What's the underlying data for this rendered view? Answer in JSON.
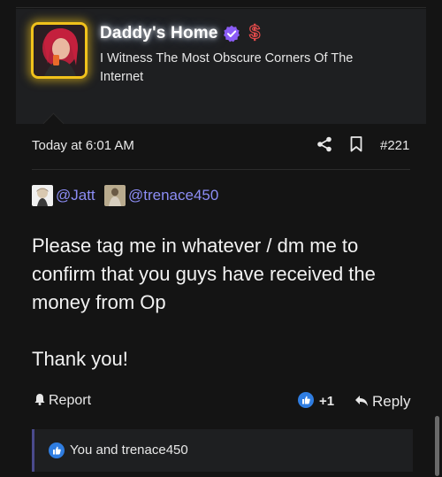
{
  "author": {
    "username": "Daddy's Home",
    "title": "I Witness The Most Obscure Corners Of The Internet",
    "badge_icon": "verified-check-icon",
    "extra_icon": "dollar-icon",
    "accent_color": "#8b5cf6"
  },
  "post": {
    "timestamp": "Today at 6:01 AM",
    "number": "#221",
    "mentions": [
      "@Jatt",
      "@trenace450"
    ],
    "message": "Please tag me in whatever / dm me to confirm that you guys have received the money from Op\n\nThank you!"
  },
  "actions": {
    "report_label": "Report",
    "like_count": "+1",
    "reply_label": "Reply"
  },
  "reactions": {
    "text": "You and trenace450"
  },
  "colors": {
    "background": "#141414",
    "card": "#1e1f21",
    "mention": "#8c8df5",
    "like_blue": "#2f7de1",
    "avatar_glow": "#f1c21b"
  }
}
